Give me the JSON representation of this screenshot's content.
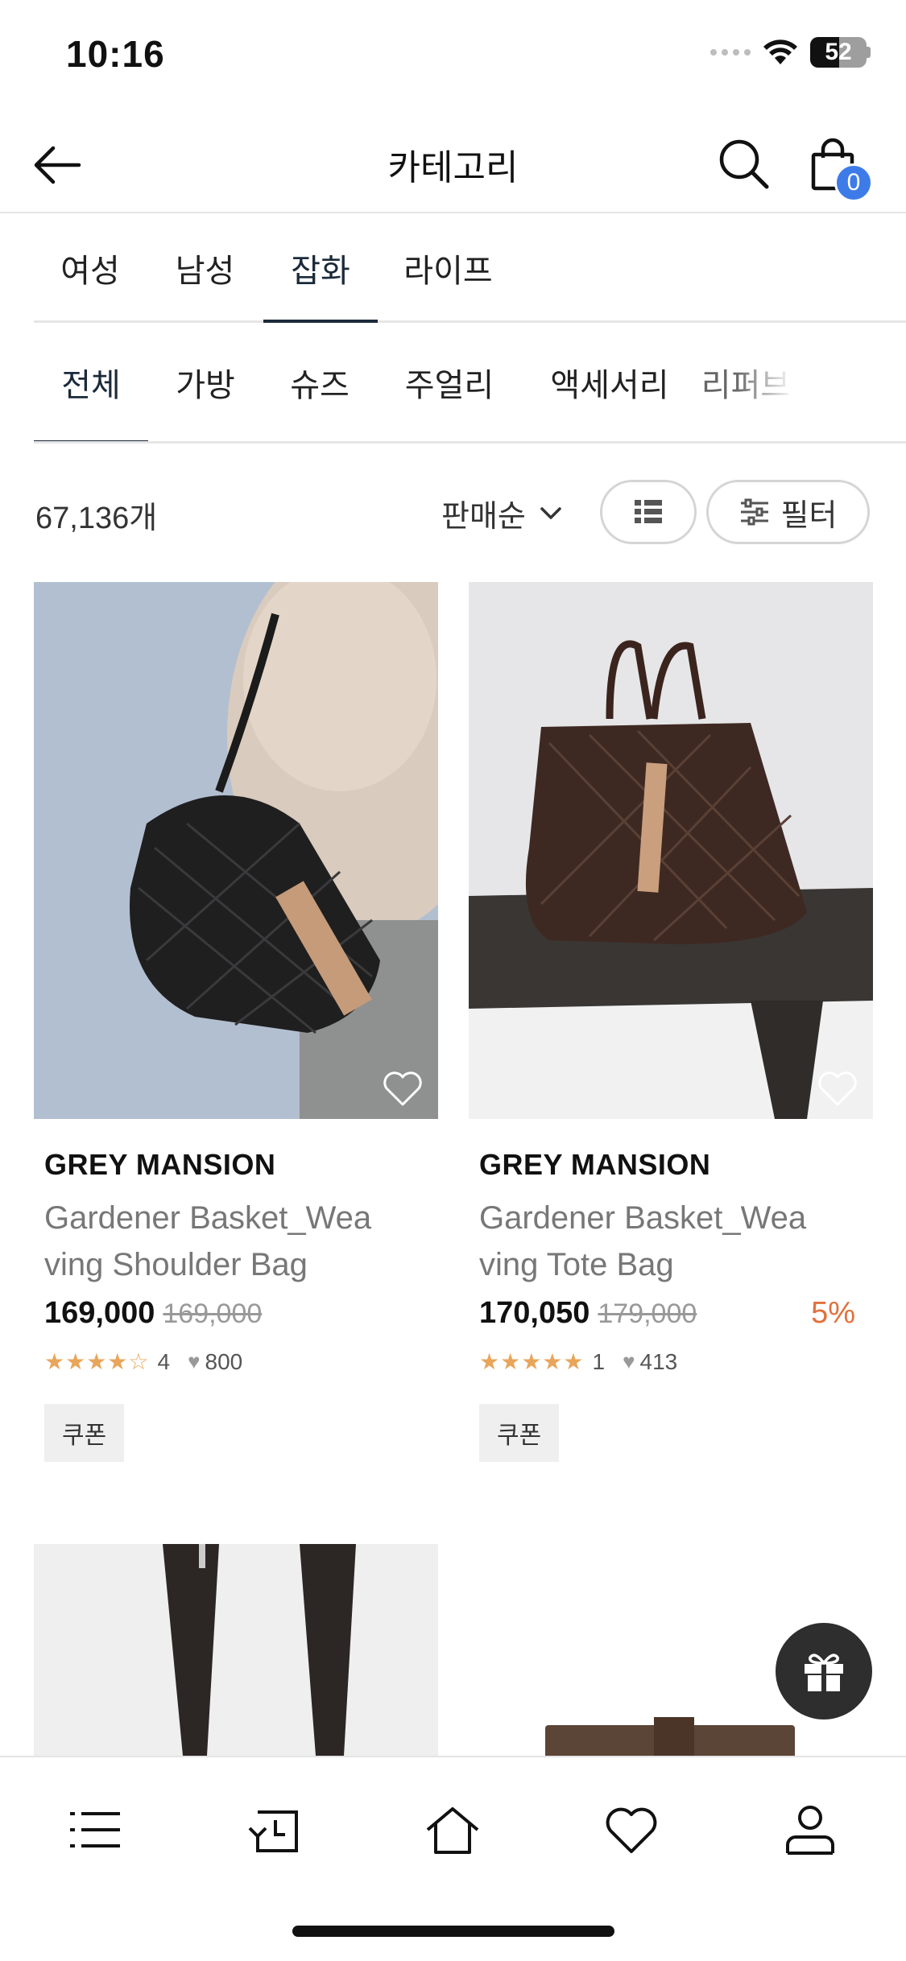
{
  "status_bar": {
    "time": "10:16",
    "battery": "52"
  },
  "header": {
    "title": "카테고리",
    "cart_count": "0"
  },
  "tabs": [
    {
      "label": "여성",
      "active": false
    },
    {
      "label": "남성",
      "active": false
    },
    {
      "label": "잡화",
      "active": true
    },
    {
      "label": "라이프",
      "active": false
    }
  ],
  "subtabs": [
    {
      "label": "전체",
      "active": true
    },
    {
      "label": "가방",
      "active": false
    },
    {
      "label": "슈즈",
      "active": false
    },
    {
      "label": "주얼리",
      "active": false
    },
    {
      "label": "액세서리",
      "active": false
    },
    {
      "label": "리퍼브",
      "active": false
    }
  ],
  "toolbar": {
    "count": "67,136개",
    "sort": "판매순",
    "filter_label": "필터"
  },
  "products": [
    {
      "brand": "GREY MANSION",
      "name_line1": "Gardener Basket_Wea",
      "name_line2": "ving Shoulder Bag",
      "price": "169,000",
      "original_price": "169,000",
      "discount": "",
      "stars": "★★★★☆",
      "rating_count": "4",
      "likes": "800",
      "coupon": "쿠폰"
    },
    {
      "brand": "GREY MANSION",
      "name_line1": "Gardener Basket_Wea",
      "name_line2": "ving Tote Bag",
      "price": "170,050",
      "original_price": "179,000",
      "discount": "5%",
      "stars": "★★★★★",
      "rating_count": "1",
      "likes": "413",
      "coupon": "쿠폰"
    }
  ],
  "colors": {
    "accent": "#3d7be8",
    "discount": "#e2703a",
    "star": "#e9a55a",
    "active_tab": "#1b2a3a"
  },
  "icons": {
    "back": "arrow-left-icon",
    "search": "search-icon",
    "cart": "shopping-bag-icon",
    "view": "list-view-icon",
    "filter": "sliders-icon",
    "wishlist": "heart-icon",
    "gift": "gift-icon",
    "nav": [
      "menu-icon",
      "recent-icon",
      "home-icon",
      "heart-icon",
      "user-icon"
    ]
  }
}
